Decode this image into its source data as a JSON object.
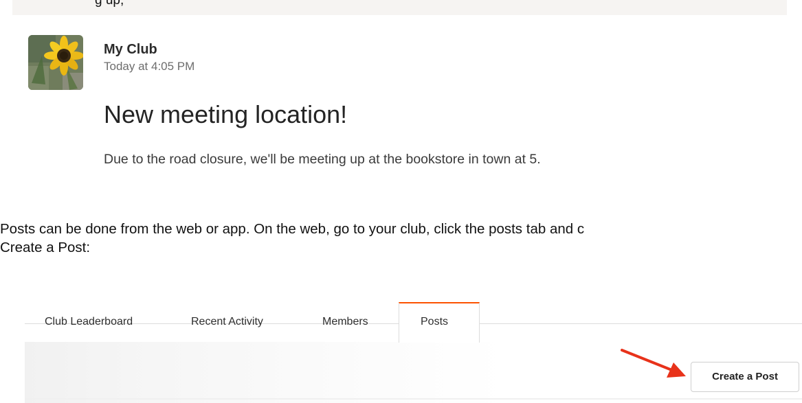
{
  "top_fragment": {
    "text": "g  up,"
  },
  "post": {
    "club_name": "My Club",
    "timestamp": "Today at 4:05 PM",
    "title": "New meeting location!",
    "body": "Due to the road closure, we'll be meeting up at the bookstore in town at 5.",
    "avatar_icon": "sunflower-avatar"
  },
  "instructions": {
    "line1": "Posts can be done from the web or app. On the web, go to your club, click the posts tab and c",
    "line2": "Create a Post:"
  },
  "club_tabs": {
    "items": [
      {
        "label": "Club Leaderboard",
        "active": false
      },
      {
        "label": "Recent Activity",
        "active": false
      },
      {
        "label": "Members",
        "active": false
      },
      {
        "label": "Posts",
        "active": true
      }
    ],
    "active_accent": "#fc5200"
  },
  "toolbar": {
    "create_post_label": "Create a Post",
    "annotation_arrow_color": "#e8321a"
  }
}
